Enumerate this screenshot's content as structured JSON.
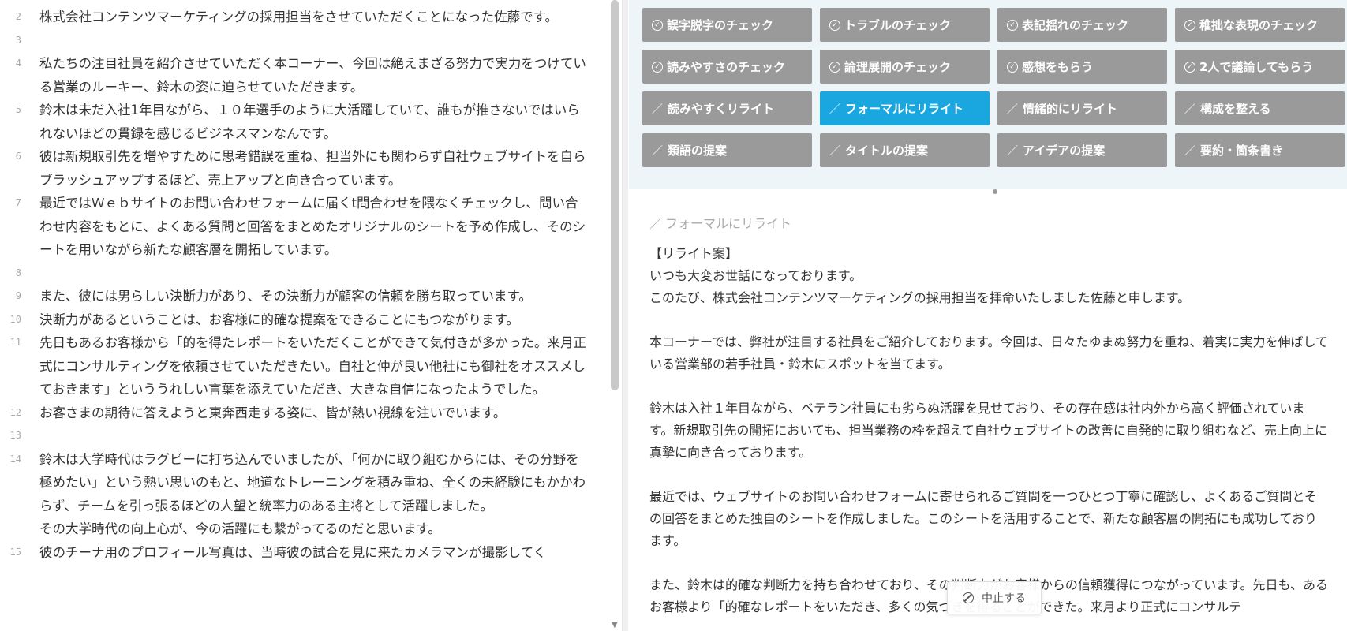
{
  "editor": {
    "lines": [
      {
        "num": "2",
        "text": "株式会社コンテンツマーケティングの採用担当をさせていただくことになった佐藤です。"
      },
      {
        "num": "3",
        "text": ""
      },
      {
        "num": "4",
        "text": "私たちの注目社員を紹介させていただく本コーナー、今回は絶えまざる努力で実力をつけている営業のルーキー、鈴木の姿に迫らせていただきます。"
      },
      {
        "num": "5",
        "text": "鈴木は未だ入社1年目ながら、１０年選手のように大活躍していて、誰もが推さないではいられないほどの貫録を感じるビジネスマンなんです。"
      },
      {
        "num": "6",
        "text": "彼は新規取引先を増やすために思考錯誤を重ね、担当外にも関わらず自社ウェブサイトを自らブラッシュアップするほど、売上アップと向き合っています。"
      },
      {
        "num": "7",
        "text": "最近ではＷｅｂサイトのお問い合わせフォームに届くt問合わせを隈なくチェックし、問い合わせ内容をもとに、よくある質問と回答をまとめたオリジナルのシートを予め作成し、そのシートを用いながら新たな顧客層を開拓しています。"
      },
      {
        "num": "8",
        "text": ""
      },
      {
        "num": "9",
        "text": "また、彼には男らしい決断力があり、その決断力が顧客の信頼を勝ち取っています。"
      },
      {
        "num": "10",
        "text": "決断力があるということは、お客様に的確な提案をできることにもつながります。"
      },
      {
        "num": "11",
        "text": "先日もあるお客様から「的を得たレポートをいただくことができて気付きが多かった。来月正式にコンサルティングを依頼させていただきたい。自社と仲が良い他社にも御社をオススメしておきます」といううれしい言葉を添えていただき、大きな自信になったようでした。"
      },
      {
        "num": "12",
        "text": "お客さまの期待に答えようと東奔西走する姿に、皆が熱い視線を注いでいます。"
      },
      {
        "num": "13",
        "text": ""
      },
      {
        "num": "14",
        "text": "鈴木は大学時代はラグビーに打ち込んでいましたが、「何かに取り組むからには、その分野を極めたい」という熱い思いのもと、地道なトレーニングを積み重ね、全くの未経験にもかかわらず、チームを引っ張るほどの人望と統率力のある主将として活躍しました。"
      },
      {
        "num": "",
        "text": "その大学時代の向上心が、今の活躍にも繋がってるのだと思います。"
      },
      {
        "num": "15",
        "text": "彼のチーナ用のプロフィール写真は、当時彼の試合を見に来たカメラマンが撮影してく"
      }
    ]
  },
  "buttons": {
    "check": [
      {
        "label": "誤字脱字のチェック"
      },
      {
        "label": "トラブルのチェック"
      },
      {
        "label": "表記揺れのチェック"
      },
      {
        "label": "稚拙な表現のチェック"
      },
      {
        "label": "読みやすさのチェック"
      },
      {
        "label": "論理展開のチェック"
      },
      {
        "label": "感想をもらう"
      },
      {
        "label": "2人で議論してもらう"
      }
    ],
    "rewrite": [
      {
        "label": "読みやすくリライト"
      },
      {
        "label": "フォーマルにリライト"
      },
      {
        "label": "情緒的にリライト"
      },
      {
        "label": "構成を整える"
      },
      {
        "label": "類語の提案"
      },
      {
        "label": "タイトルの提案"
      },
      {
        "label": "アイデアの提案"
      },
      {
        "label": "要約・箇条書き"
      }
    ],
    "active_color": "#1aa7df",
    "default_color": "#9a9a9a"
  },
  "output": {
    "heading": "フォーマルにリライト",
    "paragraphs": [
      [
        "【リライト案】",
        "いつも大変お世話になっております。",
        "このたび、株式会社コンテンツマーケティングの採用担当を拝命いたしました佐藤と申します。"
      ],
      [
        "本コーナーでは、弊社が注目する社員をご紹介しております。今回は、日々たゆまぬ努力を重ね、着実に実力を伸ばしている営業部の若手社員・鈴木にスポットを当てます。"
      ],
      [
        "鈴木は入社１年目ながら、ベテラン社員にも劣らぬ活躍を見せており、その存在感は社内外から高く評価されています。新規取引先の開拓においても、担当業務の枠を超えて自社ウェブサイトの改善に自発的に取り組むなど、売上向上に真摯に向き合っております。"
      ],
      [
        "最近では、ウェブサイトのお問い合わせフォームに寄せられるご質問を一つひとつ丁寧に確認し、よくあるご質問とその回答をまとめた独自のシートを作成しました。このシートを活用することで、新たな顧客層の開拓にも成功しております。"
      ],
      [
        "また、鈴木は的確な判断力を持ち合わせており、その判断力がお客様からの信頼獲得につながっています。先日も、あるお客様より「的確なレポートをいただき、多くの気づきを得ることができた。来月より正式にコンサルテ"
      ]
    ]
  },
  "stop_button": {
    "label": "中止する"
  }
}
